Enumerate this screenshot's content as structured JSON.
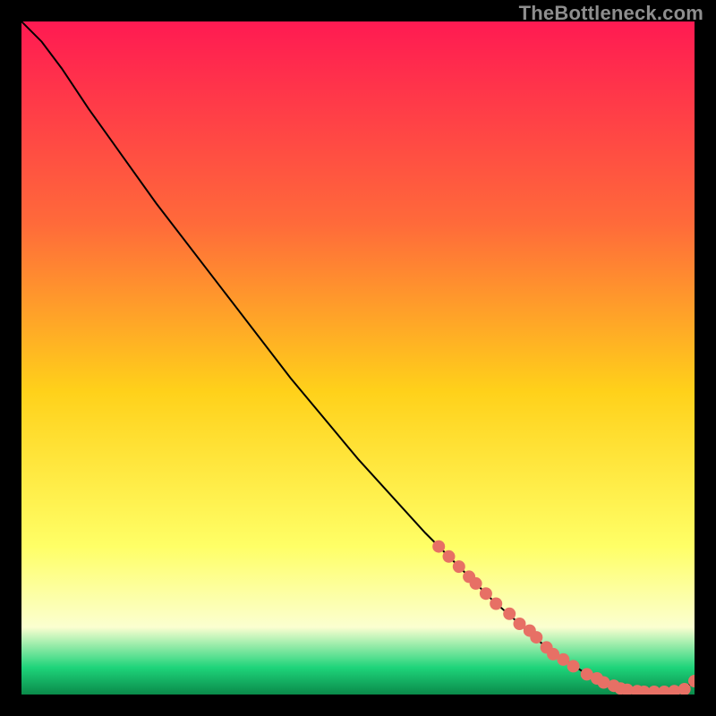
{
  "watermark": "TheBottleneck.com",
  "colors": {
    "background": "#000000",
    "gradient_top": "#ff1a52",
    "gradient_mid_upper": "#ff6a3a",
    "gradient_mid": "#ffd11a",
    "gradient_mid_lower": "#ffff66",
    "gradient_low": "#fbffd0",
    "gradient_green": "#1ed47a",
    "curve": "#000000",
    "points": "#e77065",
    "watermark": "#8e8e8e"
  },
  "chart_data": {
    "type": "line",
    "title": "",
    "xlabel": "",
    "ylabel": "",
    "xlim": [
      0,
      100
    ],
    "ylim": [
      0,
      100
    ],
    "series": [
      {
        "name": "curve",
        "x": [
          0,
          3,
          6,
          10,
          15,
          20,
          30,
          40,
          50,
          60,
          70,
          78,
          84,
          88,
          92,
          95,
          98,
          100
        ],
        "y": [
          100,
          97,
          93,
          87,
          80,
          73,
          60,
          47,
          35,
          24,
          14,
          7,
          3,
          1.5,
          0.7,
          0.4,
          0.6,
          2
        ]
      }
    ],
    "scatter": [
      {
        "name": "highlighted-points",
        "x": [
          62,
          63.5,
          65,
          66.5,
          67.5,
          69,
          70.5,
          72.5,
          74,
          75.5,
          76.5,
          78,
          79,
          80.5,
          82,
          84,
          85.5,
          86.5,
          88,
          89,
          90,
          91.5,
          92.5,
          94,
          95.5,
          97,
          98.5,
          100
        ],
        "y": [
          22,
          20.5,
          19,
          17.5,
          16.5,
          15,
          13.5,
          12,
          10.5,
          9.5,
          8.5,
          7,
          6,
          5.2,
          4.2,
          3,
          2.4,
          1.8,
          1.3,
          0.9,
          0.7,
          0.5,
          0.4,
          0.4,
          0.4,
          0.5,
          0.8,
          2
        ]
      }
    ]
  }
}
